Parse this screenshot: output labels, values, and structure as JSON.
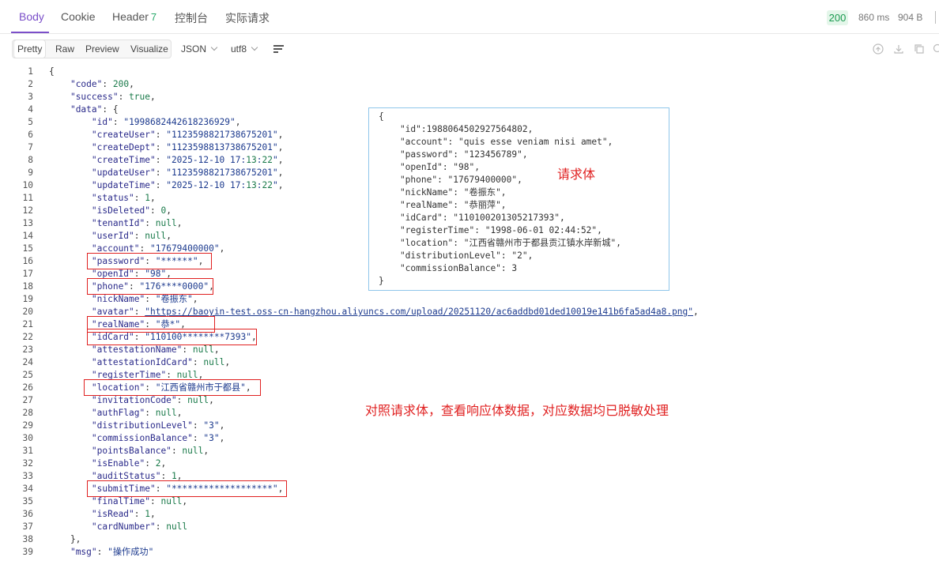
{
  "tabs": [
    {
      "label": "Body",
      "active": true
    },
    {
      "label": "Cookie"
    },
    {
      "label": "Header",
      "count": "7"
    },
    {
      "label": "控制台"
    },
    {
      "label": "实际请求"
    }
  ],
  "status": {
    "code": "200",
    "time": "860 ms",
    "size": "904 B"
  },
  "toolbar": {
    "views": [
      "Pretty",
      "Raw",
      "Preview",
      "Visualize"
    ],
    "format": "JSON",
    "encoding": "utf8"
  },
  "code_lines": [
    "{",
    "    \"code\": 200,",
    "    \"success\": true,",
    "    \"data\": {",
    "        \"id\": \"1998682442618236929\",",
    "        \"createUser\": \"1123598821738675201\",",
    "        \"createDept\": \"1123598813738675201\",",
    "        \"createTime\": \"2025-12-10 17:13:22\",",
    "        \"updateUser\": \"1123598821738675201\",",
    "        \"updateTime\": \"2025-12-10 17:13:22\",",
    "        \"status\": 1,",
    "        \"isDeleted\": 0,",
    "        \"tenantId\": null,",
    "        \"userId\": null,",
    "        \"account\": \"17679400000\",",
    "        \"password\": \"******\",",
    "        \"openId\": \"98\",",
    "        \"phone\": \"176****0000\",",
    "        \"nickName\": \"卷振东\",",
    "        \"avatar\": \"https://baoyin-test.oss-cn-hangzhou.aliyuncs.com/upload/20251120/ac6addbd01ded10019e141b6fa5ad4a8.png\",",
    "        \"realName\": \"恭*\",",
    "        \"idCard\": \"110100********7393\",",
    "        \"attestationName\": null,",
    "        \"attestationIdCard\": null,",
    "        \"registerTime\": null,",
    "        \"location\": \"江西省赣州市于都县\",",
    "        \"invitationCode\": null,",
    "        \"authFlag\": null,",
    "        \"distributionLevel\": \"3\",",
    "        \"commissionBalance\": \"3\",",
    "        \"pointsBalance\": null,",
    "        \"isEnable\": 2,",
    "        \"auditStatus\": 1,",
    "        \"submitTime\": \"*******************\",",
    "        \"finalTime\": null,",
    "        \"isRead\": 1,",
    "        \"cardNumber\": null",
    "    },",
    "    \"msg\": \"操作成功\""
  ],
  "request_panel": {
    "label": "请求体",
    "lines": [
      "{",
      "    \"id\":1988064502927564802,",
      "    \"account\": \"quis esse veniam nisi amet\",",
      "    \"password\": \"123456789\",",
      "    \"openId\": \"98\",",
      "    \"phone\": \"17679400000\",",
      "    \"nickName\": \"卷振东\",",
      "    \"realName\": \"恭丽萍\",",
      "    \"idCard\": \"110100201305217393\",",
      "    \"registerTime\": \"1998-06-01 02:44:52\",",
      "    \"location\": \"江西省赣州市于都县贡江镇水岸新城\",",
      "    \"distributionLevel\": \"2\",",
      "    \"commissionBalance\": 3",
      "}"
    ]
  },
  "annotation": "对照请求体，查看响应体数据，对应数据均已脱敏处理",
  "highlighted_lines": [
    16,
    18,
    21,
    22,
    26,
    34
  ]
}
